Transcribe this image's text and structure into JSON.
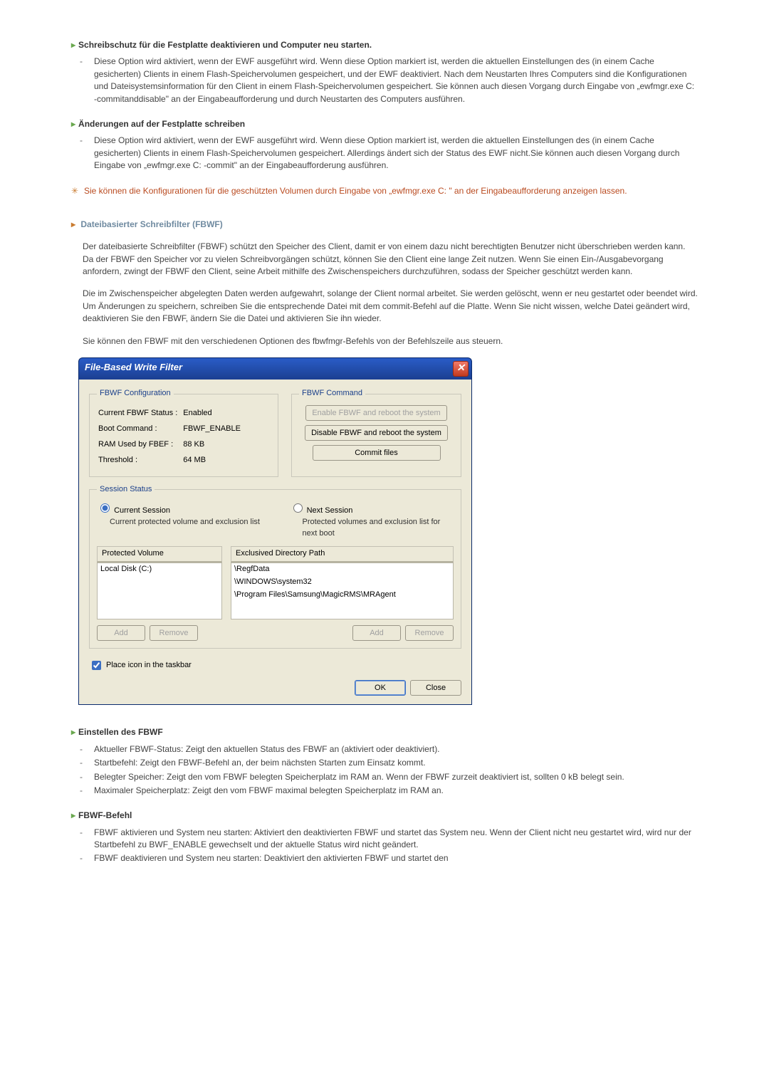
{
  "sections": {
    "s1": {
      "title": "Schreibschutz für die Festplatte deaktivieren und Computer neu starten.",
      "item": "Diese Option wird aktiviert, wenn der EWF ausgeführt wird. Wenn diese Option markiert ist, werden die aktuellen Einstellungen des (in einem Cache gesicherten) Clients in einem Flash-Speichervolumen gespeichert, und der EWF deaktiviert. Nach dem Neustarten Ihres Computers sind die Konfigurationen und Dateisystemsinformation für den Client in einem Flash-Speichervolumen gespeichert. Sie können auch diesen Vorgang durch Eingabe von „ewfmgr.exe C: -commitanddisable\" an der Eingabeaufforderung und durch Neustarten des Computers ausführen."
    },
    "s2": {
      "title": "Änderungen auf der Festplatte schreiben",
      "item": "Diese Option wird aktiviert, wenn der EWF ausgeführt wird. Wenn diese Option markiert ist, werden die aktuellen Einstellungen des (in einem Cache gesicherten) Clients in einem Flash-Speichervolumen gespeichert. Allerdings ändert sich der Status des EWF nicht.Sie können auch diesen Vorgang durch Eingabe von „ewfmgr.exe C: -commit\" an der Eingabeaufforderung ausführen."
    },
    "note": "Sie können die Konfigurationen für die geschützten Volumen durch Eingabe von „ewfmgr.exe C: \" an der Eingabeaufforderung anzeigen lassen.",
    "fbwf_heading": "Dateibasierter Schreibfilter (FBWF)",
    "p1": "Der dateibasierte Schreibfilter (FBWF) schützt den Speicher des Client, damit er von einem dazu nicht berechtigten Benutzer nicht überschrieben werden kann. Da der FBWF den Speicher vor zu vielen Schreibvorgängen schützt, können Sie den Client eine lange Zeit nutzen. Wenn Sie einen Ein-/Ausgabevorgang anfordern, zwingt der FBWF den Client, seine Arbeit mithilfe des Zwischenspeichers durchzuführen, sodass der Speicher geschützt werden kann.",
    "p2": "Die im Zwischenspeicher abgelegten Daten werden aufgewahrt, solange der Client normal arbeitet. Sie werden gelöscht, wenn er neu gestartet oder beendet wird. Um Änderungen zu speichern, schreiben Sie die entsprechende Datei mit dem commit-Befehl auf die Platte. Wenn Sie nicht wissen, welche Datei geändert wird, deaktivieren Sie den FBWF, ändern Sie die Datei und aktivieren Sie ihn wieder.",
    "p3": "Sie können den FBWF mit den verschiedenen Optionen des fbwfmgr-Befehls von der Befehlszeile aus steuern.",
    "einstellen_title": "Einstellen des FBWF",
    "einstellen_items": [
      "Aktueller FBWF-Status: Zeigt den aktuellen Status des FBWF an (aktiviert oder deaktiviert).",
      "Startbefehl: Zeigt den FBWF-Befehl an, der beim nächsten Starten zum Einsatz kommt.",
      "Belegter Speicher: Zeigt den vom FBWF belegten Speicherplatz im RAM an. Wenn der FBWF zurzeit deaktiviert ist, sollten 0 kB belegt sein.",
      "Maximaler Speicherplatz: Zeigt den vom FBWF maximal belegten Speicherplatz im RAM an."
    ],
    "befehl_title": "FBWF-Befehl",
    "befehl_items": [
      "FBWF aktivieren und System neu starten: Aktiviert den deaktivierten FBWF und startet das System neu. Wenn der Client nicht neu gestartet wird, wird nur der Startbefehl zu BWF_ENABLE gewechselt und der aktuelle Status wird nicht geändert.",
      "FBWF deaktivieren und System neu starten: Deaktiviert den aktivierten FBWF und startet den"
    ]
  },
  "dialog": {
    "title": "File-Based Write Filter",
    "config": {
      "legend": "FBWF Configuration",
      "rows": {
        "status_lbl": "Current FBWF Status :",
        "status_val": "Enabled",
        "boot_lbl": "Boot Command :",
        "boot_val": "FBWF_ENABLE",
        "ram_lbl": "RAM Used by FBEF :",
        "ram_val": "88 KB",
        "thresh_lbl": "Threshold :",
        "thresh_val": "64 MB"
      }
    },
    "command": {
      "legend": "FBWF Command",
      "btn_enable": "Enable FBWF and reboot the system",
      "btn_disable": "Disable FBWF and reboot the system",
      "btn_commit": "Commit files"
    },
    "session": {
      "legend": "Session Status",
      "current_lbl": "Current Session",
      "current_desc": "Current  protected volume and exclusion list",
      "next_lbl": "Next Session",
      "next_desc": "Protected volumes and exclusion list for next boot",
      "col_protected": "Protected Volume",
      "col_exclusive": "Exclusived Directory Path",
      "protected_items": [
        "Local Disk (C:)"
      ],
      "exclusive_items": [
        "\\RegfData",
        "\\WINDOWS\\system32",
        "\\Program Files\\Samsung\\MagicRMS\\MRAgent"
      ],
      "add": "Add",
      "remove": "Remove"
    },
    "taskbar_check": "Place icon in the taskbar",
    "ok": "OK",
    "close": "Close"
  }
}
